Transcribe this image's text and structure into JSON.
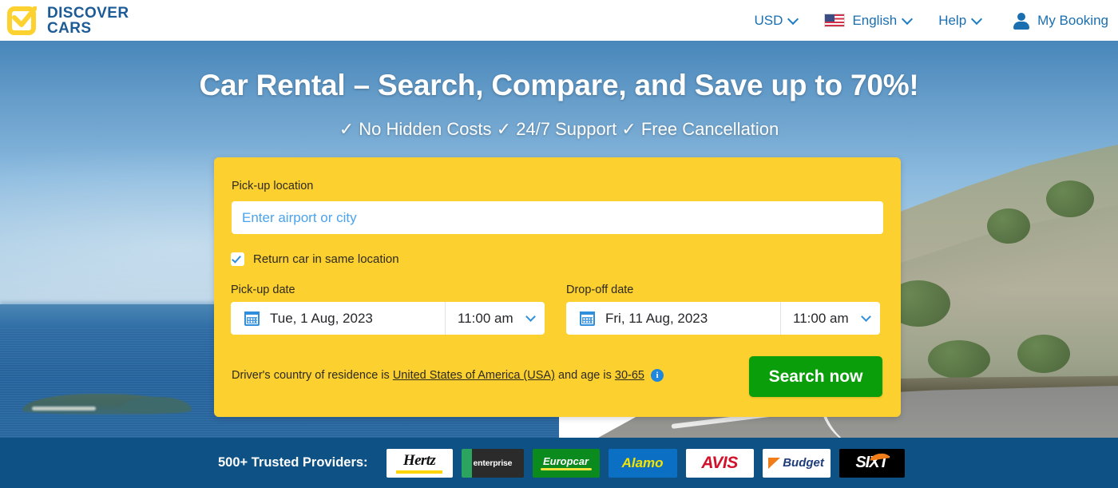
{
  "header": {
    "logo": {
      "line1": "DISCOVER",
      "line2": "CARS",
      "icon": "checkbox-check-icon"
    },
    "nav": {
      "currency": "USD",
      "language": "English",
      "language_flag": "us-flag-icon",
      "help": "Help",
      "booking": "My Booking",
      "booking_icon": "person-icon"
    }
  },
  "hero": {
    "title": "Car Rental – Search, Compare, and Save up to 70%!",
    "subtitle": "✓ No Hidden Costs ✓ 24/7 Support ✓ Free Cancellation"
  },
  "search_form": {
    "pickup_location_label": "Pick-up location",
    "pickup_location_value": "",
    "pickup_location_placeholder": "Enter airport or city",
    "same_location_label": "Return car in same location",
    "same_location_checked": true,
    "pickup_date_label": "Pick-up date",
    "pickup_date_value": "Tue, 1 Aug, 2023",
    "pickup_time_value": "11:00 am",
    "dropoff_date_label": "Drop-off date",
    "dropoff_date_value": "Fri, 11 Aug, 2023",
    "dropoff_time_value": "11:00 am",
    "driver_text_before": "Driver's country of residence is",
    "driver_country": "United States of America (USA)",
    "driver_text_middle": "and age is",
    "driver_age": "30-65",
    "info_icon": "info-icon",
    "search_button": "Search now"
  },
  "providers": {
    "label": "500+ Trusted Providers:",
    "brands": [
      {
        "name": "Hertz"
      },
      {
        "name": "enterprise"
      },
      {
        "name": "Europcar"
      },
      {
        "name": "Alamo"
      },
      {
        "name": "AVIS"
      },
      {
        "name": "Budget"
      },
      {
        "name": "SIXT"
      }
    ]
  },
  "colors": {
    "brand_yellow": "#fbd02f",
    "brand_blue": "#0e5285",
    "accent_link_blue": "#1a6fb0",
    "search_green": "#0a9e0a"
  }
}
